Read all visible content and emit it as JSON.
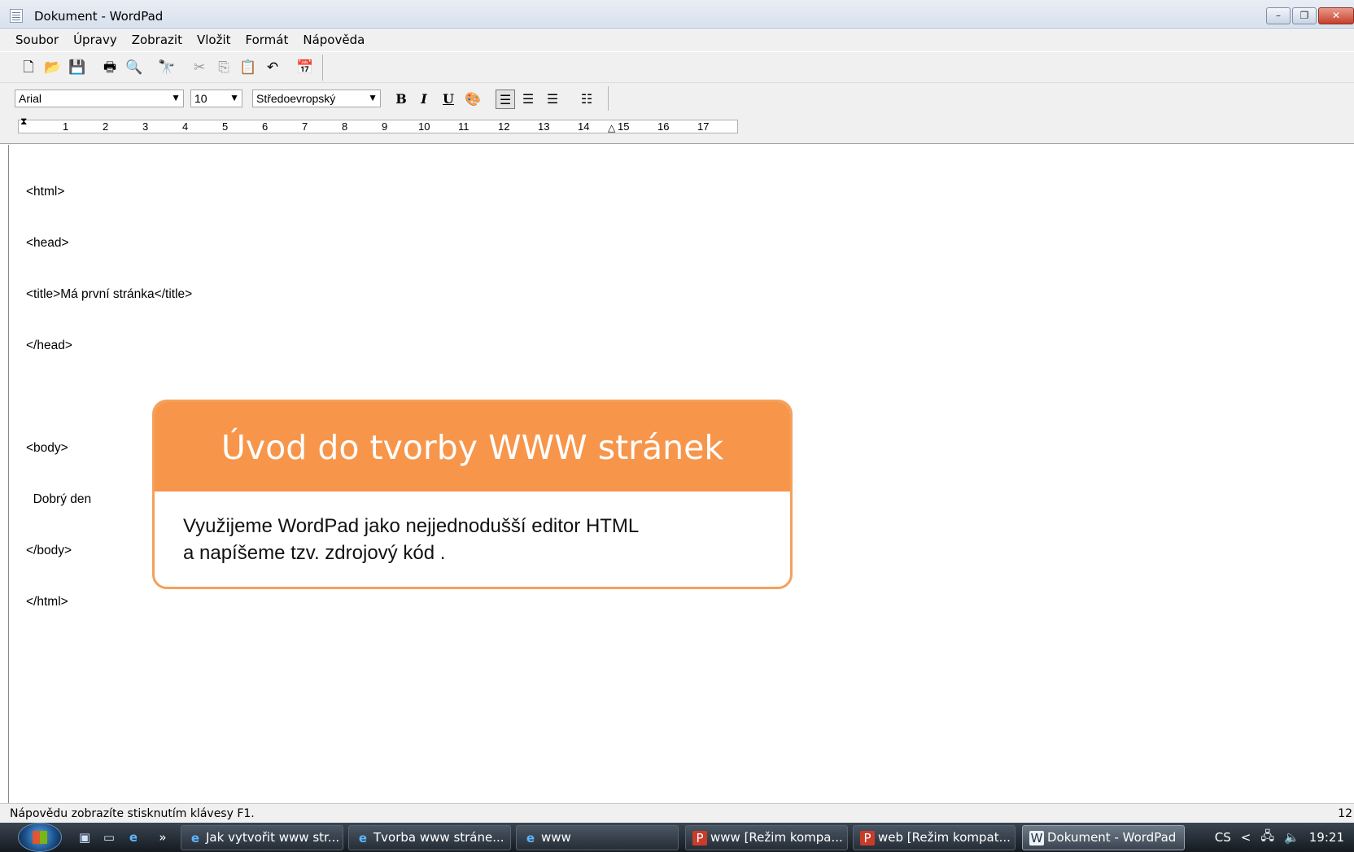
{
  "window": {
    "title": "Dokument - WordPad",
    "controls": {
      "minimize": "–",
      "restore": "❐",
      "close": "✕"
    }
  },
  "menu": [
    "Soubor",
    "Úpravy",
    "Zobrazit",
    "Vložit",
    "Formát",
    "Nápověda"
  ],
  "toolbar": {
    "icons": [
      "new-document",
      "open-folder",
      "save",
      "print",
      "print-preview",
      "find",
      "cut",
      "copy",
      "paste",
      "undo",
      "insert-date-time"
    ]
  },
  "format_bar": {
    "font": "Arial",
    "size": "10",
    "script": "Středoevropský",
    "bold": "B",
    "italic": "I",
    "underline": "U",
    "color": "color-palette",
    "align": [
      "left",
      "center",
      "right"
    ],
    "active_align": "left",
    "bullets": "bullet-list"
  },
  "ruler": {
    "numbers": [
      "1",
      "2",
      "3",
      "4",
      "5",
      "6",
      "7",
      "8",
      "9",
      "10",
      "11",
      "12",
      "13",
      "14",
      "15",
      "16",
      "17"
    ]
  },
  "document": {
    "lines": [
      "<html>",
      "<head>",
      "<title>Má první stránka</title>",
      "</head>",
      "",
      "<body>",
      "  Dobrý den",
      "</body>",
      "</html>"
    ]
  },
  "callout": {
    "title": "Úvod do tvorby WWW stránek",
    "line1": "Využijeme WordPad jako nejjednodušší editor HTML",
    "line2": "a napíšeme  tzv. zdrojový kód ."
  },
  "status": {
    "text": "Nápovědu zobrazíte stisknutím klávesy F1.",
    "right": "12"
  },
  "taskbar": {
    "quicklaunch_chevron": "»",
    "tasks": [
      {
        "label": "Jak vytvořit www str...",
        "icon": "ie-icon",
        "active": false
      },
      {
        "label": "Tvorba www stráne...",
        "icon": "ie-icon",
        "active": false
      },
      {
        "label": "www",
        "icon": "ie-icon",
        "active": false
      },
      {
        "label": "www [Režim kompa...",
        "icon": "powerpoint-icon",
        "active": false
      },
      {
        "label": "web [Režim kompat...",
        "icon": "powerpoint-icon",
        "active": false
      },
      {
        "label": "Dokument - WordPad",
        "icon": "wordpad-icon",
        "active": true
      }
    ],
    "language": "CS",
    "tray_chevron": "<",
    "clock": "19:21"
  }
}
